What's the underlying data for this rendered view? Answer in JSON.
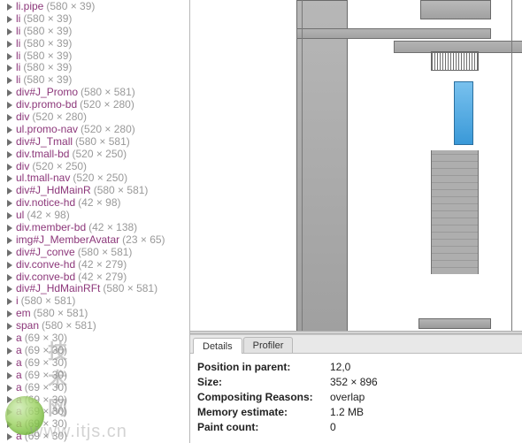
{
  "tree": [
    {
      "label": "li.pipe",
      "dims": "(580 × 39)"
    },
    {
      "label": "li",
      "dims": "(580 × 39)"
    },
    {
      "label": "li",
      "dims": "(580 × 39)"
    },
    {
      "label": "li",
      "dims": "(580 × 39)"
    },
    {
      "label": "li",
      "dims": "(580 × 39)"
    },
    {
      "label": "li",
      "dims": "(580 × 39)"
    },
    {
      "label": "li",
      "dims": "(580 × 39)"
    },
    {
      "label": "div#J_Promo",
      "dims": "(580 × 581)"
    },
    {
      "label": "div.promo-bd",
      "dims": "(520 × 280)"
    },
    {
      "label": "div",
      "dims": "(520 × 280)"
    },
    {
      "label": "ul.promo-nav",
      "dims": "(520 × 280)"
    },
    {
      "label": "div#J_Tmall",
      "dims": "(580 × 581)"
    },
    {
      "label": "div.tmall-bd",
      "dims": "(520 × 250)"
    },
    {
      "label": "div",
      "dims": "(520 × 250)"
    },
    {
      "label": "ul.tmall-nav",
      "dims": "(520 × 250)"
    },
    {
      "label": "div#J_HdMainR",
      "dims": "(580 × 581)"
    },
    {
      "label": "div.notice-hd",
      "dims": "(42 × 98)"
    },
    {
      "label": "ul",
      "dims": "(42 × 98)"
    },
    {
      "label": "div.member-bd",
      "dims": "(42 × 138)"
    },
    {
      "label": "img#J_MemberAvatar",
      "dims": "(23 × 65)"
    },
    {
      "label": "div#J_conve",
      "dims": "(580 × 581)"
    },
    {
      "label": "div.conve-hd",
      "dims": "(42 × 279)"
    },
    {
      "label": "div.conve-bd",
      "dims": "(42 × 279)"
    },
    {
      "label": "div#J_HdMainRFt",
      "dims": "(580 × 581)"
    },
    {
      "label": "i",
      "dims": "(580 × 581)"
    },
    {
      "label": "em",
      "dims": "(580 × 581)"
    },
    {
      "label": "span",
      "dims": "(580 × 581)"
    },
    {
      "label": "a",
      "dims": "(69 × 30)"
    },
    {
      "label": "a",
      "dims": "(69 × 30)"
    },
    {
      "label": "a",
      "dims": "(69 × 30)"
    },
    {
      "label": "a",
      "dims": "(69 × 30)"
    },
    {
      "label": "a",
      "dims": "(69 × 30)"
    },
    {
      "label": "a",
      "dims": "(69 × 30)"
    },
    {
      "label": "a",
      "dims": "(69 × 30)"
    },
    {
      "label": "a",
      "dims": "(69 × 30)"
    },
    {
      "label": "a",
      "dims": "(69 × 30)"
    }
  ],
  "tabs": {
    "details": "Details",
    "profiler": "Profiler"
  },
  "details": {
    "rows": [
      {
        "key": "Position in parent:",
        "val": "12,0"
      },
      {
        "key": "Size:",
        "val": "352 × 896"
      },
      {
        "key": "Compositing Reasons:",
        "val": "overlap"
      },
      {
        "key": "Memory estimate:",
        "val": "1.2 MB"
      },
      {
        "key": "Paint count:",
        "val": "0"
      }
    ]
  },
  "watermark": {
    "text1": "技术网",
    "text2": "www.itjs.cn"
  }
}
